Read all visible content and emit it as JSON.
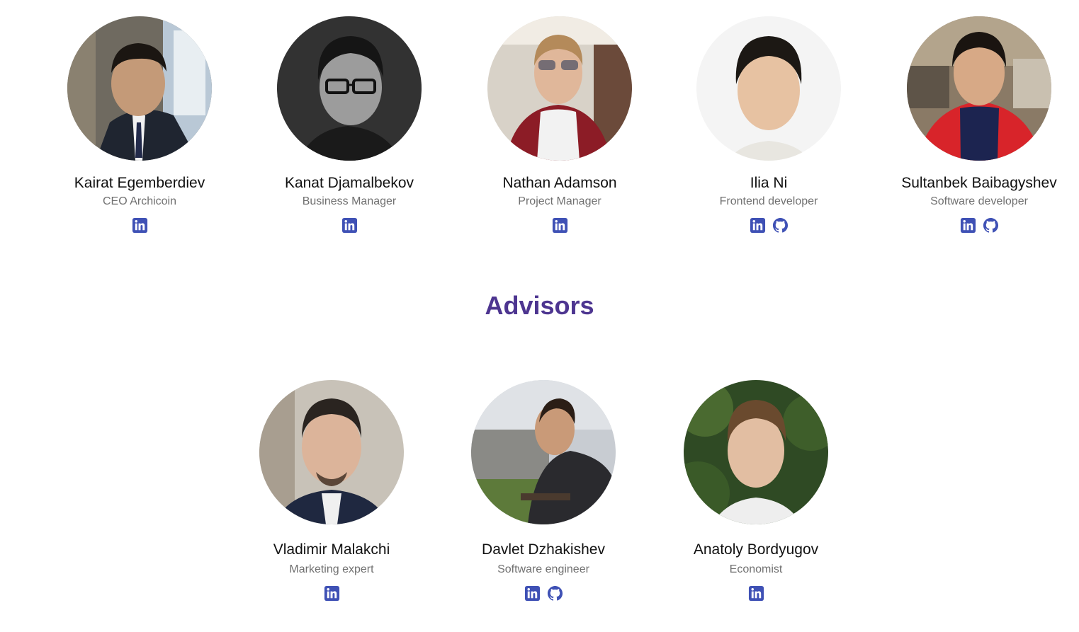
{
  "colors": {
    "accent": "#4d3590",
    "icon": "#3f51b5",
    "role_text": "#707070",
    "name_text": "#111111"
  },
  "team": [
    {
      "name": "Kairat Egemberdiev",
      "role": "CEO Archicoin",
      "photo_desc": "avatar-photo",
      "links": [
        "linkedin-icon"
      ]
    },
    {
      "name": "Kanat Djamalbekov",
      "role": "Business Manager",
      "links": [
        "linkedin-icon"
      ]
    },
    {
      "name": "Nathan Adamson",
      "role": "Project Manager",
      "links": [
        "linkedin-icon"
      ]
    },
    {
      "name": "Ilia Ni",
      "role": "Frontend developer",
      "links": [
        "linkedin-icon",
        "github-icon"
      ]
    },
    {
      "name": "Sultanbek Baibagyshev",
      "role": "Software developer",
      "links": [
        "linkedin-icon",
        "github-icon"
      ]
    }
  ],
  "advisors_title": "Advisors",
  "advisors": [
    {
      "name": "Vladimir Malakchi",
      "role": "Marketing expert",
      "links": [
        "linkedin-icon"
      ]
    },
    {
      "name": "Davlet Dzhakishev",
      "role": "Software engineer",
      "links": [
        "linkedin-icon",
        "github-icon"
      ]
    },
    {
      "name": "Anatoly Bordyugov",
      "role": "Economist",
      "links": [
        "linkedin-icon"
      ]
    }
  ]
}
